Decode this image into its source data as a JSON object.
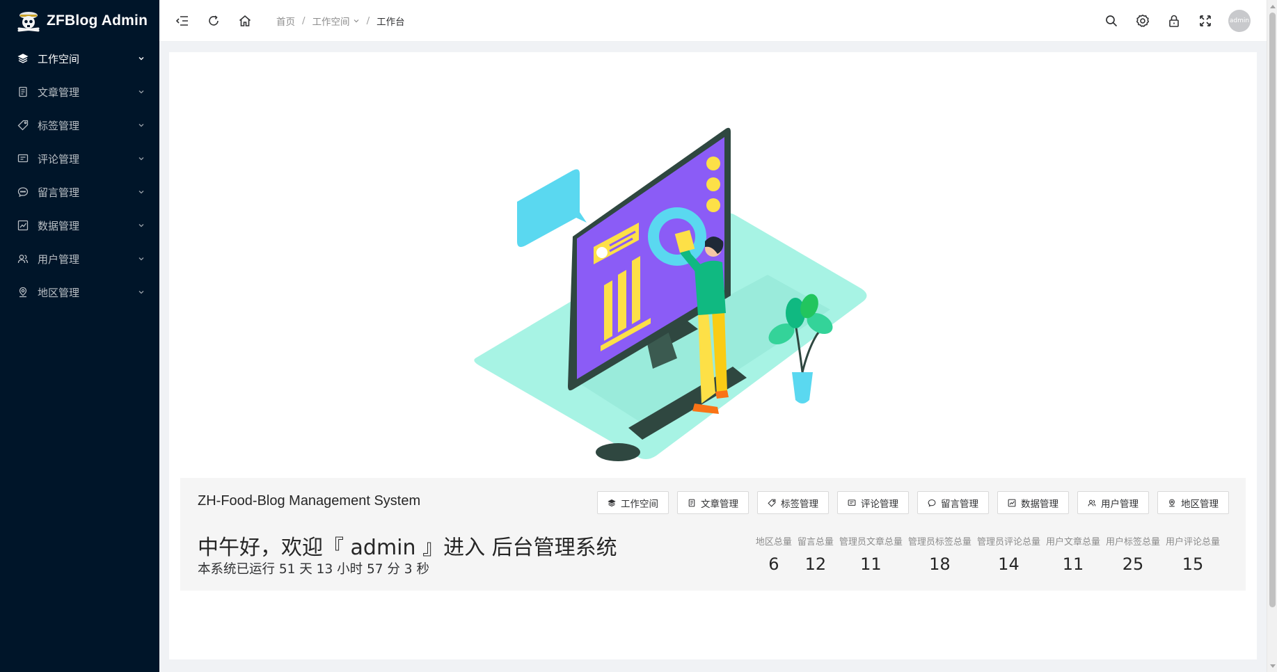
{
  "app": {
    "title": "ZFBlog Admin"
  },
  "sidebar": {
    "items": [
      {
        "label": "工作空间",
        "icon": "layers-icon"
      },
      {
        "label": "文章管理",
        "icon": "document-icon"
      },
      {
        "label": "标签管理",
        "icon": "tag-icon"
      },
      {
        "label": "评论管理",
        "icon": "comment-icon"
      },
      {
        "label": "留言管理",
        "icon": "message-icon"
      },
      {
        "label": "数据管理",
        "icon": "chart-icon"
      },
      {
        "label": "用户管理",
        "icon": "users-icon"
      },
      {
        "label": "地区管理",
        "icon": "location-icon"
      }
    ]
  },
  "header": {
    "breadcrumb": {
      "home": "首页",
      "section": "工作空间",
      "current": "工作台"
    },
    "avatar_text": "admin"
  },
  "panel": {
    "system_title": "ZH-Food-Blog Management System",
    "greeting": "中午好，欢迎『 admin 』进入 后台管理系统",
    "runtime": "本系统已运行 51 天 13 小时 57 分 3 秒",
    "quick_buttons": [
      {
        "label": "工作空间",
        "icon": "layers-icon"
      },
      {
        "label": "文章管理",
        "icon": "document-icon"
      },
      {
        "label": "标签管理",
        "icon": "tag-icon"
      },
      {
        "label": "评论管理",
        "icon": "comment-icon"
      },
      {
        "label": "留言管理",
        "icon": "message-icon"
      },
      {
        "label": "数据管理",
        "icon": "chart-icon"
      },
      {
        "label": "用户管理",
        "icon": "users-icon"
      },
      {
        "label": "地区管理",
        "icon": "location-icon"
      }
    ],
    "stats": [
      {
        "label": "地区总量",
        "value": "6"
      },
      {
        "label": "留言总量",
        "value": "12"
      },
      {
        "label": "管理员文章总量",
        "value": "11"
      },
      {
        "label": "管理员标签总量",
        "value": "18"
      },
      {
        "label": "管理员评论总量",
        "value": "14"
      },
      {
        "label": "用户文章总量",
        "value": "11"
      },
      {
        "label": "用户标签总量",
        "value": "25"
      },
      {
        "label": "用户评论总量",
        "value": "15"
      }
    ]
  },
  "colors": {
    "sidebar_bg": "#001529",
    "accent_purple": "#8b5cf6",
    "accent_mint": "#a7f3e4",
    "accent_yellow": "#fde047",
    "accent_cyan": "#5ad8f0"
  }
}
